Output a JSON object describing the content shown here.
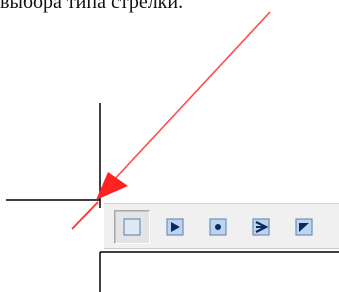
{
  "caption": {
    "text": "выбора типа стрелки."
  },
  "toolbar": {
    "buttons": [
      {
        "name": "arrow-none-button",
        "icon": "square-outline-icon",
        "selected": true
      },
      {
        "name": "arrow-triangle-button",
        "icon": "filled-triangle-arrowhead-icon",
        "selected": false
      },
      {
        "name": "arrow-dot-button",
        "icon": "dot-arrowhead-icon",
        "selected": false
      },
      {
        "name": "arrow-open-button",
        "icon": "open-arrowhead-icon",
        "selected": false
      },
      {
        "name": "arrow-half-button",
        "icon": "half-arrowhead-icon",
        "selected": false
      }
    ]
  },
  "colors": {
    "arrow": "#ff3333",
    "icon_dark": "#0a2a5a",
    "icon_fill": "#bcd4f0",
    "icon_border": "#6f8fb8",
    "toolbar_bg": "#f0f0f0"
  }
}
